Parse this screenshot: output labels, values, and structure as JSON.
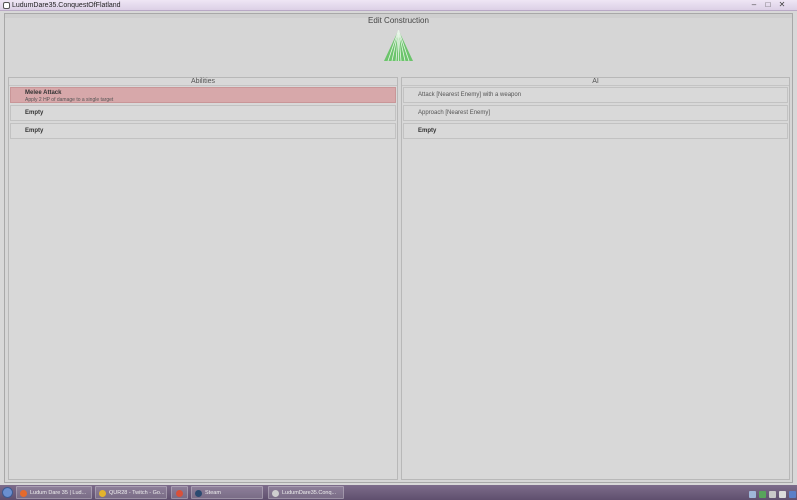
{
  "titlebar": {
    "title": "LudumDare35.ConquestOfFlatland",
    "min_label": "–",
    "max_label": "□",
    "close_label": "✕"
  },
  "dialog": {
    "title": "Edit Construction"
  },
  "abilities": {
    "header": "Abilities",
    "items": [
      {
        "title": "Melee Attack",
        "desc": "Apply 2 HP of damage to a single target"
      },
      {
        "title": "Empty",
        "desc": ""
      },
      {
        "title": "Empty",
        "desc": ""
      }
    ]
  },
  "ai": {
    "header": "AI",
    "items": [
      {
        "title": "Attack [Nearest Enemy] with a weapon"
      },
      {
        "title": "Approach [Nearest Enemy]"
      },
      {
        "title": "Empty"
      }
    ]
  },
  "taskbar": {
    "items": [
      {
        "label": "Ludum Dare 35 | Lud...",
        "icon": "firefox-icon"
      },
      {
        "label": "QUR28 - Twitch - Go...",
        "icon": "chrome-icon"
      },
      {
        "label": "",
        "icon": "app-icon"
      },
      {
        "label": "Steam",
        "icon": "steam-icon"
      },
      {
        "label": "LudumDare35.Conq...",
        "icon": "game-icon"
      }
    ]
  },
  "colors": {
    "selected_row": "#d7a8aa",
    "pyramid_green": "#6cc46c",
    "taskbar": "#6b5a7b"
  }
}
